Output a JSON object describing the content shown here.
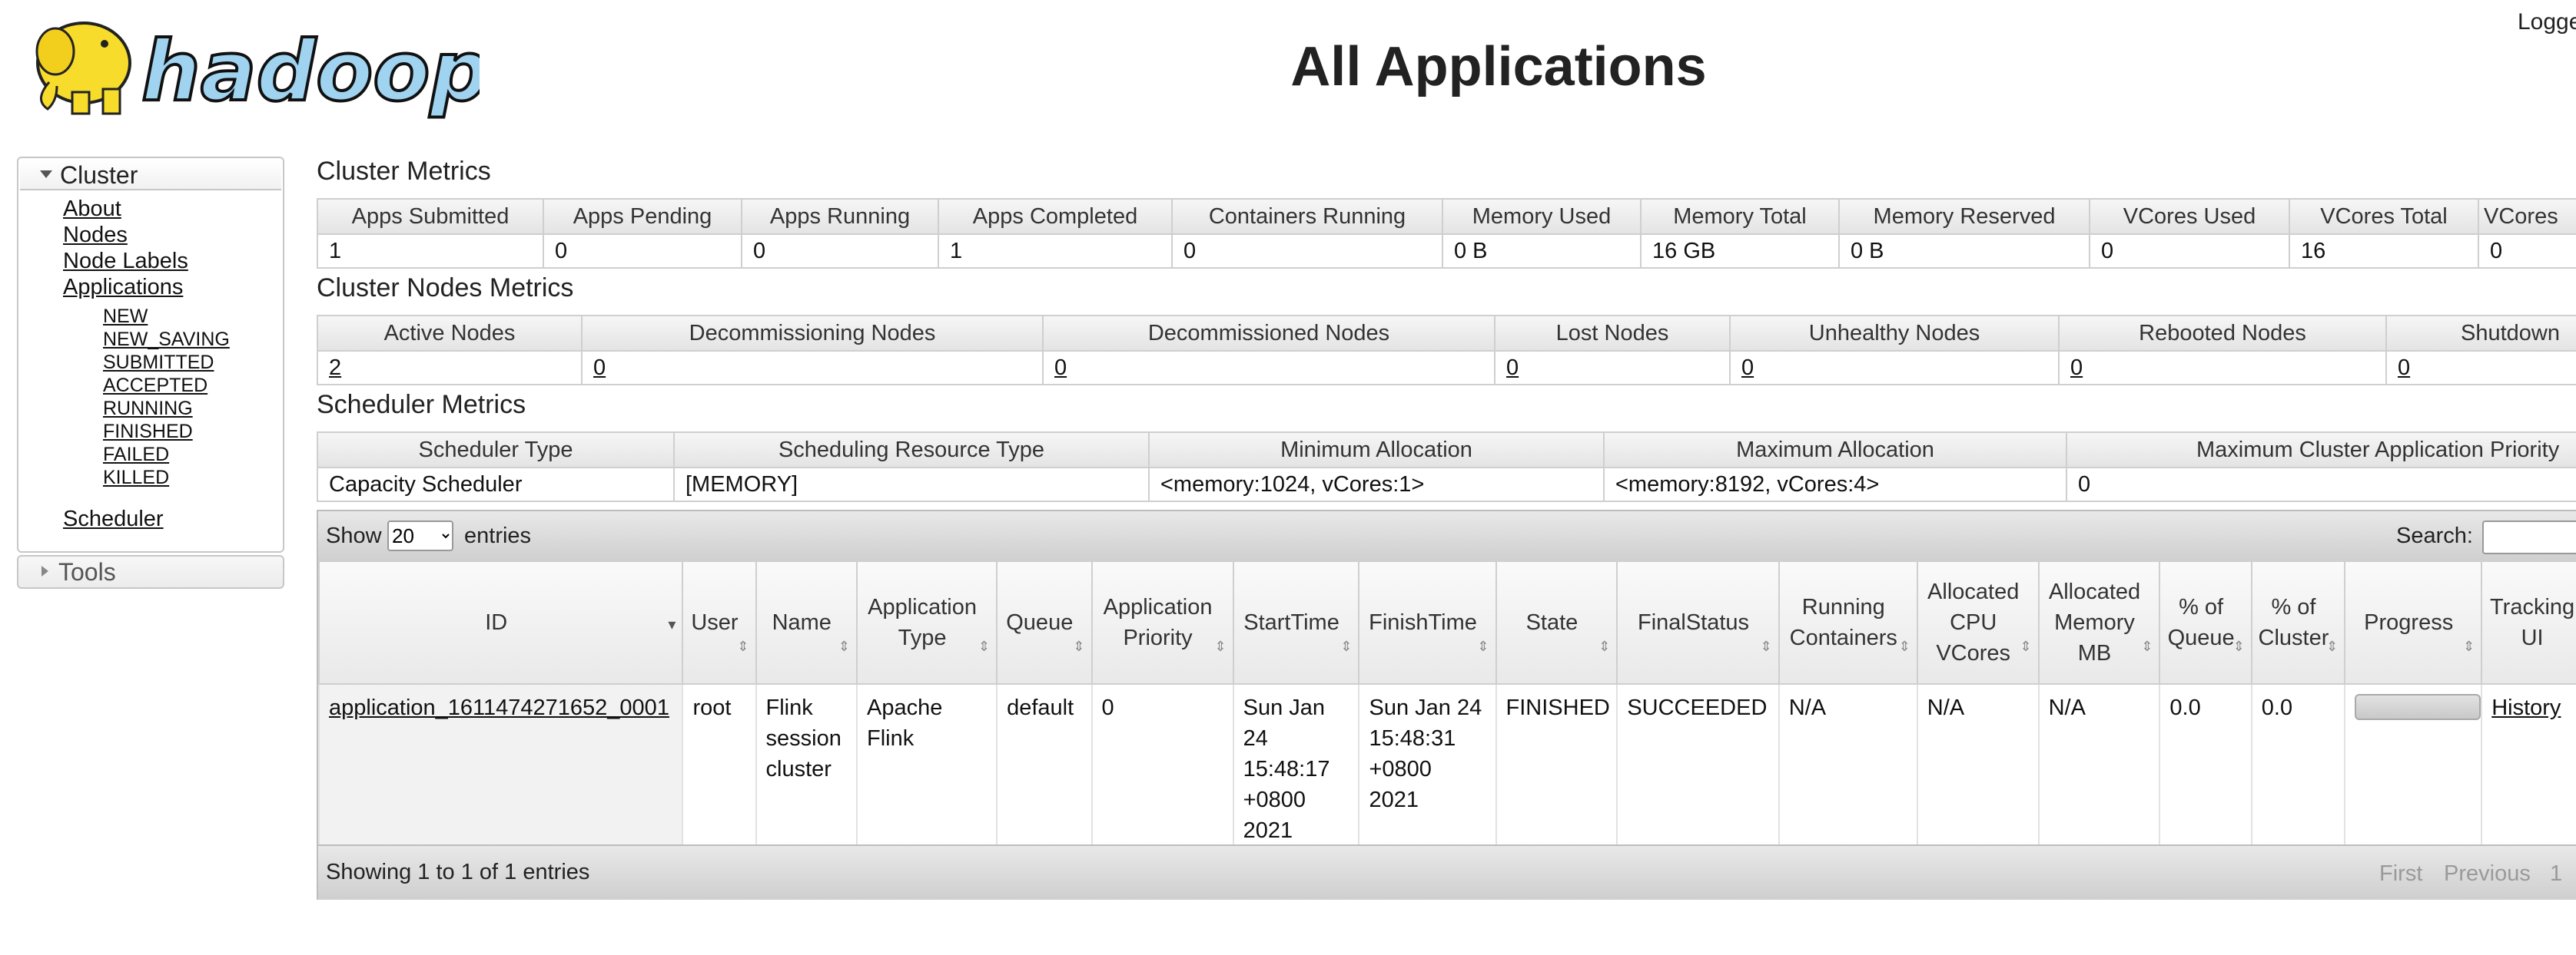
{
  "header": {
    "logo_text": "hadoop",
    "title": "All Applications",
    "logged_in": "Logge"
  },
  "nav": {
    "cluster_label": "Cluster",
    "links": [
      "About",
      "Nodes",
      "Node Labels",
      "Applications"
    ],
    "app_states": [
      "NEW",
      "NEW_SAVING",
      "SUBMITTED",
      "ACCEPTED",
      "RUNNING",
      "FINISHED",
      "FAILED",
      "KILLED"
    ],
    "scheduler": "Scheduler",
    "tools_label": "Tools"
  },
  "cluster_metrics": {
    "title": "Cluster Metrics",
    "headers": [
      "Apps Submitted",
      "Apps Pending",
      "Apps Running",
      "Apps Completed",
      "Containers Running",
      "Memory Used",
      "Memory Total",
      "Memory Reserved",
      "VCores Used",
      "VCores Total",
      "VCores"
    ],
    "values": [
      "1",
      "0",
      "0",
      "1",
      "0",
      "0 B",
      "16 GB",
      "0 B",
      "0",
      "16",
      "0"
    ]
  },
  "nodes_metrics": {
    "title": "Cluster Nodes Metrics",
    "headers": [
      "Active Nodes",
      "Decommissioning Nodes",
      "Decommissioned Nodes",
      "Lost Nodes",
      "Unhealthy Nodes",
      "Rebooted Nodes",
      "Shutdown"
    ],
    "values": [
      "2",
      "0",
      "0",
      "0",
      "0",
      "0",
      "0"
    ]
  },
  "scheduler_metrics": {
    "title": "Scheduler Metrics",
    "headers": [
      "Scheduler Type",
      "Scheduling Resource Type",
      "Minimum Allocation",
      "Maximum Allocation",
      "Maximum Cluster Application Priority"
    ],
    "values": [
      "Capacity Scheduler",
      "[MEMORY]",
      "<memory:1024, vCores:1>",
      "<memory:8192, vCores:4>",
      "0"
    ]
  },
  "apps": {
    "show_label": "Show",
    "page_length": "20",
    "entries_label": "entries",
    "search_label": "Search:",
    "headers": [
      "ID",
      "User",
      "Name",
      "Application Type",
      "Queue",
      "Application Priority",
      "StartTime",
      "FinishTime",
      "State",
      "FinalStatus",
      "Running Containers",
      "Allocated CPU VCores",
      "Allocated Memory MB",
      "% of Queue",
      "% of Cluster",
      "Progress",
      "Tracking UI"
    ],
    "row": {
      "id": "application_1611474271652_0001",
      "user": "root",
      "name": "Flink session cluster",
      "type": "Apache Flink",
      "queue": "default",
      "priority": "0",
      "start": "Sun Jan 24 15:48:17 +0800 2021",
      "finish": "Sun Jan 24 15:48:31 +0800 2021",
      "state": "FINISHED",
      "final_status": "SUCCEEDED",
      "running_containers": "N/A",
      "alloc_vcores": "N/A",
      "alloc_mem": "N/A",
      "pct_queue": "0.0",
      "pct_cluster": "0.0",
      "progress": 0,
      "tracking": "History"
    },
    "info": "Showing 1 to 1 of 1 entries",
    "pager": {
      "first": "First",
      "previous": "Previous",
      "page": "1"
    }
  },
  "colors": {
    "logo_blue": "#9fd3f0",
    "logo_yellow": "#f7dc2c"
  }
}
